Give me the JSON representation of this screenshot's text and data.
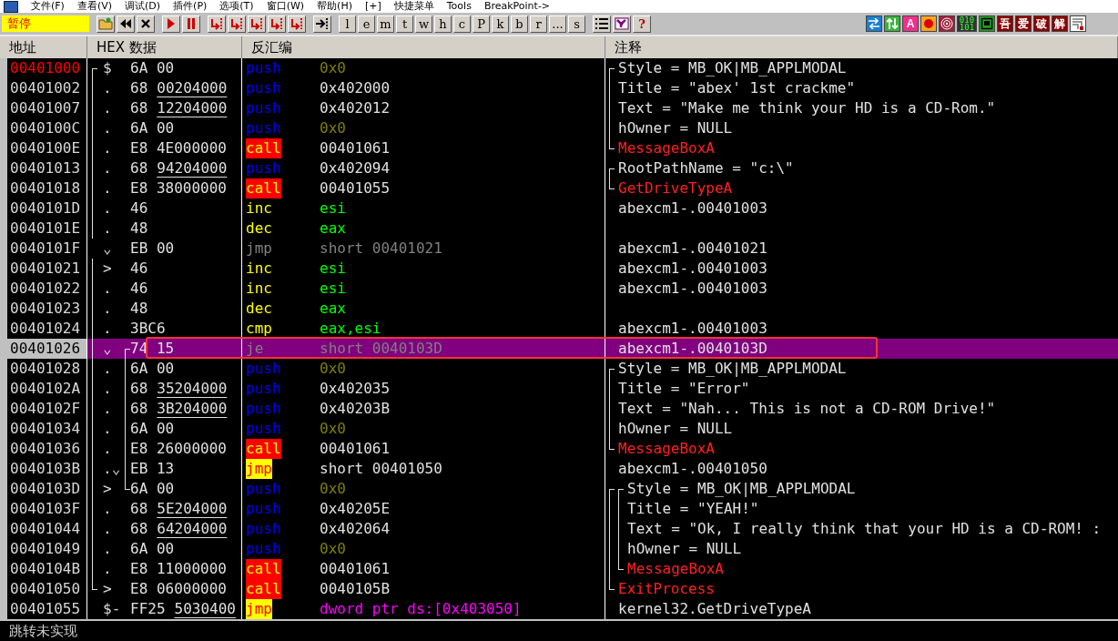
{
  "menu": [
    "文件(F)",
    "查看(V)",
    "调试(D)",
    "插件(P)",
    "选项(T)",
    "窗口(W)",
    "帮助(H)",
    "[+]",
    "快捷菜单",
    "Tools",
    "BreakPoint->"
  ],
  "toolbar": {
    "status": "暂停",
    "letters": [
      "l",
      "e",
      "m",
      "t",
      "w",
      "h",
      "c",
      "P",
      "k",
      "b",
      "r",
      "...",
      "s"
    ],
    "help": "?",
    "plugins": [
      {
        "kind": "swap"
      },
      {
        "kind": "updown"
      },
      {
        "kind": "letter",
        "text": "A"
      },
      {
        "kind": "record"
      },
      {
        "kind": "target"
      },
      {
        "kind": "binary",
        "lines": [
          "010",
          "101"
        ]
      },
      {
        "kind": "window"
      },
      {
        "kind": "char",
        "text": "吾"
      },
      {
        "kind": "char",
        "text": "爱"
      },
      {
        "kind": "char",
        "text": "破"
      },
      {
        "kind": "char",
        "text": "解"
      },
      {
        "kind": "corner"
      }
    ]
  },
  "columns": [
    "地址",
    "HEX 数据",
    "反汇编",
    "注释"
  ],
  "rows": [
    {
      "addr": "00401000",
      "current": true,
      "selected": false,
      "annotated": false,
      "marker": "$",
      "proc": {
        "kind": "start"
      },
      "hex": "6A 00",
      "mnemonic": {
        "text": "push",
        "kind": "push"
      },
      "operand": {
        "text": "0x0",
        "kind": "imm"
      },
      "comment": {
        "text": "Style = MB_OK|MB_APPLMODAL",
        "kind": "note"
      },
      "bracket": {
        "kind": "start"
      }
    },
    {
      "addr": "00401002",
      "current": false,
      "selected": false,
      "annotated": false,
      "marker": ".",
      "proc": {
        "kind": "mid"
      },
      "hex": "68",
      "reloc": "00204000",
      "mnemonic": {
        "text": "push",
        "kind": "push"
      },
      "operand": {
        "text": "0x402000",
        "kind": "value"
      },
      "comment": {
        "text": "Title = \"abex' 1st crackme\"",
        "kind": "note"
      },
      "bracket": {
        "kind": "mid"
      }
    },
    {
      "addr": "00401007",
      "current": false,
      "selected": false,
      "annotated": false,
      "marker": ".",
      "proc": {
        "kind": "mid"
      },
      "hex": "68",
      "reloc": "12204000",
      "mnemonic": {
        "text": "push",
        "kind": "push"
      },
      "operand": {
        "text": "0x402012",
        "kind": "value"
      },
      "comment": {
        "text": "Text = \"Make me think your HD is a CD-Rom.\"",
        "kind": "note"
      },
      "bracket": {
        "kind": "mid"
      }
    },
    {
      "addr": "0040100C",
      "current": false,
      "selected": false,
      "annotated": false,
      "marker": ".",
      "proc": {
        "kind": "mid"
      },
      "hex": "6A 00",
      "mnemonic": {
        "text": "push",
        "kind": "push"
      },
      "operand": {
        "text": "0x0",
        "kind": "imm"
      },
      "comment": {
        "text": "hOwner = NULL",
        "kind": "note"
      },
      "bracket": {
        "kind": "mid"
      }
    },
    {
      "addr": "0040100E",
      "current": false,
      "selected": false,
      "annotated": false,
      "marker": ".",
      "proc": {
        "kind": "mid"
      },
      "hex": "E8 4E000000",
      "mnemonic": {
        "text": "call",
        "kind": "call"
      },
      "operand": {
        "text": "00401061",
        "kind": "value"
      },
      "comment": {
        "text": "MessageBoxA",
        "kind": "api"
      },
      "bracket": {
        "kind": "end"
      }
    },
    {
      "addr": "00401013",
      "current": false,
      "selected": false,
      "annotated": false,
      "marker": ".",
      "proc": {
        "kind": "mid"
      },
      "hex": "68",
      "reloc": "94204000",
      "mnemonic": {
        "text": "push",
        "kind": "push"
      },
      "operand": {
        "text": "0x402094",
        "kind": "value"
      },
      "comment": {
        "text": "RootPathName = \"c:\\\"",
        "kind": "note"
      },
      "bracket": {
        "kind": "start"
      }
    },
    {
      "addr": "00401018",
      "current": false,
      "selected": false,
      "annotated": false,
      "marker": ".",
      "proc": {
        "kind": "mid"
      },
      "hex": "E8 38000000",
      "mnemonic": {
        "text": "call",
        "kind": "call"
      },
      "operand": {
        "text": "00401055",
        "kind": "value"
      },
      "comment": {
        "text": "GetDriveTypeA",
        "kind": "api"
      },
      "bracket": {
        "kind": "end"
      }
    },
    {
      "addr": "0040101D",
      "current": false,
      "selected": false,
      "annotated": false,
      "marker": ".",
      "proc": {
        "kind": "mid"
      },
      "hex": "46",
      "mnemonic": {
        "text": "inc",
        "kind": "op"
      },
      "operand": {
        "text": "esi",
        "kind": "reg"
      },
      "comment": {
        "text": "abexcm1-.00401003",
        "kind": "note"
      }
    },
    {
      "addr": "0040101E",
      "current": false,
      "selected": false,
      "annotated": false,
      "marker": ".",
      "proc": {
        "kind": "mid"
      },
      "hex": "48",
      "mnemonic": {
        "text": "dec",
        "kind": "op"
      },
      "operand": {
        "text": "eax",
        "kind": "reg"
      }
    },
    {
      "addr": "0040101F",
      "current": false,
      "selected": false,
      "annotated": false,
      "marker": "⌄",
      "hex": "EB 00",
      "mnemonic": {
        "text": "jmp",
        "kind": "branch"
      },
      "operand": {
        "text": "short 00401021",
        "kind": "branch"
      },
      "comment": {
        "text": "abexcm1-.00401021",
        "kind": "note"
      }
    },
    {
      "addr": "00401021",
      "current": false,
      "selected": false,
      "annotated": false,
      "marker": ">",
      "proc": {
        "kind": "mid"
      },
      "hex": "46",
      "mnemonic": {
        "text": "inc",
        "kind": "op"
      },
      "operand": {
        "text": "esi",
        "kind": "reg"
      },
      "comment": {
        "text": "abexcm1-.00401003",
        "kind": "note"
      }
    },
    {
      "addr": "00401022",
      "current": false,
      "selected": false,
      "annotated": false,
      "marker": ".",
      "proc": {
        "kind": "mid"
      },
      "hex": "46",
      "mnemonic": {
        "text": "inc",
        "kind": "op"
      },
      "operand": {
        "text": "esi",
        "kind": "reg"
      },
      "comment": {
        "text": "abexcm1-.00401003",
        "kind": "note"
      }
    },
    {
      "addr": "00401023",
      "current": false,
      "selected": false,
      "annotated": false,
      "marker": ".",
      "proc": {
        "kind": "mid"
      },
      "hex": "48",
      "mnemonic": {
        "text": "dec",
        "kind": "op"
      },
      "operand": {
        "text": "eax",
        "kind": "reg"
      }
    },
    {
      "addr": "00401024",
      "current": false,
      "selected": false,
      "annotated": false,
      "marker": ".",
      "proc": {
        "kind": "mid"
      },
      "hex": "3BC6",
      "mnemonic": {
        "text": "cmp",
        "kind": "op"
      },
      "operand": {
        "text": "eax,esi",
        "kind": "reg"
      },
      "comment": {
        "text": "abexcm1-.00401003",
        "kind": "note"
      }
    },
    {
      "addr": "00401026",
      "current": false,
      "selected": true,
      "annotated": true,
      "marker": "⌄",
      "proc": {
        "kind": "mid"
      },
      "jump": {
        "kind": "start"
      },
      "hex": "74 15",
      "mnemonic": {
        "text": "je",
        "kind": "branch"
      },
      "operand": {
        "text": "short 0040103D",
        "kind": "branch"
      },
      "comment": {
        "text": "abexcm1-.0040103D",
        "kind": "note"
      }
    },
    {
      "addr": "00401028",
      "current": false,
      "selected": false,
      "annotated": false,
      "marker": ".",
      "proc": {
        "kind": "mid"
      },
      "jump": {
        "kind": "mid"
      },
      "hex": "6A 00",
      "mnemonic": {
        "text": "push",
        "kind": "push"
      },
      "operand": {
        "text": "0x0",
        "kind": "imm"
      },
      "comment": {
        "text": "Style = MB_OK|MB_APPLMODAL",
        "kind": "note"
      },
      "bracket": {
        "kind": "start"
      }
    },
    {
      "addr": "0040102A",
      "current": false,
      "selected": false,
      "annotated": false,
      "marker": ".",
      "proc": {
        "kind": "mid"
      },
      "jump": {
        "kind": "mid"
      },
      "hex": "68",
      "reloc": "35204000",
      "mnemonic": {
        "text": "push",
        "kind": "push"
      },
      "operand": {
        "text": "0x402035",
        "kind": "value"
      },
      "comment": {
        "text": "Title = \"Error\"",
        "kind": "note"
      },
      "bracket": {
        "kind": "mid"
      }
    },
    {
      "addr": "0040102F",
      "current": false,
      "selected": false,
      "annotated": false,
      "marker": ".",
      "proc": {
        "kind": "mid"
      },
      "jump": {
        "kind": "mid"
      },
      "hex": "68",
      "reloc": "3B204000",
      "mnemonic": {
        "text": "push",
        "kind": "push"
      },
      "operand": {
        "text": "0x40203B",
        "kind": "value"
      },
      "comment": {
        "text": "Text = \"Nah... This is not a CD-ROM Drive!\"",
        "kind": "note"
      },
      "bracket": {
        "kind": "mid"
      }
    },
    {
      "addr": "00401034",
      "current": false,
      "selected": false,
      "annotated": false,
      "marker": ".",
      "proc": {
        "kind": "mid"
      },
      "jump": {
        "kind": "mid"
      },
      "hex": "6A 00",
      "mnemonic": {
        "text": "push",
        "kind": "push"
      },
      "operand": {
        "text": "0x0",
        "kind": "imm"
      },
      "comment": {
        "text": "hOwner = NULL",
        "kind": "note"
      },
      "bracket": {
        "kind": "mid"
      }
    },
    {
      "addr": "00401036",
      "current": false,
      "selected": false,
      "annotated": false,
      "marker": ".",
      "proc": {
        "kind": "mid"
      },
      "jump": {
        "kind": "mid"
      },
      "hex": "E8 26000000",
      "mnemonic": {
        "text": "call",
        "kind": "call"
      },
      "operand": {
        "text": "00401061",
        "kind": "value"
      },
      "comment": {
        "text": "MessageBoxA",
        "kind": "api"
      },
      "bracket": {
        "kind": "end"
      }
    },
    {
      "addr": "0040103B",
      "current": false,
      "selected": false,
      "annotated": false,
      "marker": ".⌄",
      "proc": {
        "kind": "mid"
      },
      "jump": {
        "kind": "mid"
      },
      "hex": "EB 13",
      "mnemonic": {
        "text": "jmp",
        "kind": "jump"
      },
      "operand": {
        "text": "short 00401050",
        "kind": "value"
      },
      "comment": {
        "text": "abexcm1-.00401050",
        "kind": "note"
      }
    },
    {
      "addr": "0040103D",
      "current": false,
      "selected": false,
      "annotated": false,
      "marker": ">",
      "proc": {
        "kind": "mid"
      },
      "jump": {
        "kind": "end"
      },
      "hex": "6A 00",
      "mnemonic": {
        "text": "push",
        "kind": "push"
      },
      "operand": {
        "text": "0x0",
        "kind": "imm"
      },
      "comment": {
        "text": "Style = MB_OK|MB_APPLMODAL",
        "kind": "note"
      },
      "bracket": {
        "kind": "start"
      },
      "outer": {
        "kind": "start"
      }
    },
    {
      "addr": "0040103F",
      "current": false,
      "selected": false,
      "annotated": false,
      "marker": ".",
      "proc": {
        "kind": "mid"
      },
      "hex": "68",
      "reloc": "5E204000",
      "mnemonic": {
        "text": "push",
        "kind": "push"
      },
      "operand": {
        "text": "0x40205E",
        "kind": "value"
      },
      "comment": {
        "text": "Title = \"YEAH!\"",
        "kind": "note"
      },
      "bracket": {
        "kind": "mid"
      },
      "outer": {
        "kind": "mid"
      }
    },
    {
      "addr": "00401044",
      "current": false,
      "selected": false,
      "annotated": false,
      "marker": ".",
      "proc": {
        "kind": "mid"
      },
      "hex": "68",
      "reloc": "64204000",
      "mnemonic": {
        "text": "push",
        "kind": "push"
      },
      "operand": {
        "text": "0x402064",
        "kind": "value"
      },
      "comment": {
        "text": "Text = \"Ok, I really think that your HD is a CD-ROM! :",
        "kind": "note"
      },
      "bracket": {
        "kind": "mid"
      },
      "outer": {
        "kind": "mid"
      }
    },
    {
      "addr": "00401049",
      "current": false,
      "selected": false,
      "annotated": false,
      "marker": ".",
      "proc": {
        "kind": "mid"
      },
      "hex": "6A 00",
      "mnemonic": {
        "text": "push",
        "kind": "push"
      },
      "operand": {
        "text": "0x0",
        "kind": "imm"
      },
      "comment": {
        "text": "hOwner = NULL",
        "kind": "note"
      },
      "bracket": {
        "kind": "mid"
      },
      "outer": {
        "kind": "mid"
      }
    },
    {
      "addr": "0040104B",
      "current": false,
      "selected": false,
      "annotated": false,
      "marker": ".",
      "proc": {
        "kind": "mid"
      },
      "hex": "E8 11000000",
      "mnemonic": {
        "text": "call",
        "kind": "call"
      },
      "operand": {
        "text": "00401061",
        "kind": "value"
      },
      "comment": {
        "text": "MessageBoxA",
        "kind": "api"
      },
      "bracket": {
        "kind": "end"
      },
      "outer": {
        "kind": "mid"
      }
    },
    {
      "addr": "00401050",
      "current": false,
      "selected": false,
      "annotated": false,
      "marker": ">",
      "proc": {
        "kind": "end"
      },
      "hex": "E8 06000000",
      "mnemonic": {
        "text": "call",
        "kind": "call"
      },
      "operand": {
        "text": "0040105B",
        "kind": "value"
      },
      "comment": {
        "text": "ExitProcess",
        "kind": "api"
      },
      "outer": {
        "kind": "end"
      }
    },
    {
      "addr": "00401055",
      "current": false,
      "selected": false,
      "annotated": false,
      "marker": "$-",
      "hex": "FF25",
      "reloc": "5030400",
      "mnemonic": {
        "text": "jmp",
        "kind": "jump"
      },
      "operand": {
        "text": "dword ptr ds:[0x403050]",
        "kind": "mem"
      },
      "comment": {
        "text": "kernel32.GetDriveTypeA",
        "kind": "note"
      }
    }
  ],
  "status": "跳转未实现"
}
